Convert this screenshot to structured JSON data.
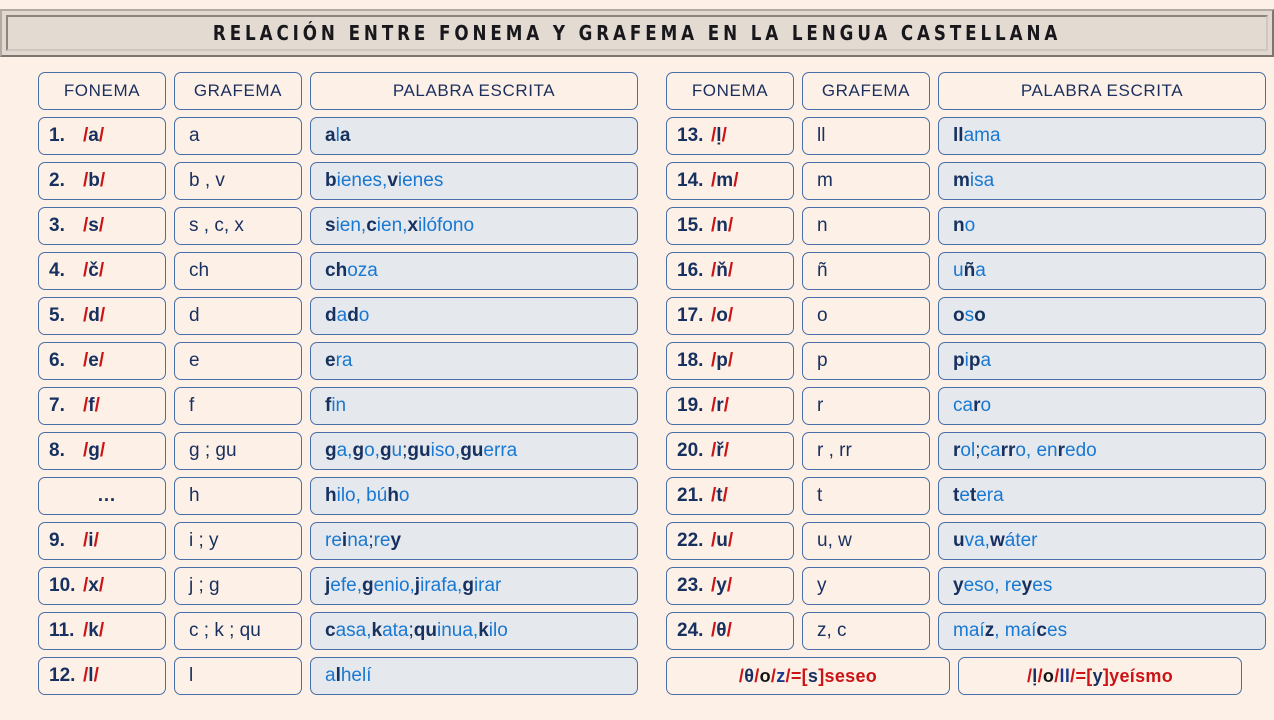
{
  "title": "RELACIÓN ENTRE FONEMA Y GRAFEMA EN LA LENGUA CASTELLANA",
  "columns": {
    "fonema": "FONEMA",
    "grafema": "GRAFEMA",
    "palabra": "PALABRA ESCRITA"
  },
  "left_rows": [
    {
      "num": "1.",
      "phoneme": "a",
      "grafema": "a",
      "palabra": "ala",
      "word_parts": [
        [
          "a",
          "g"
        ],
        [
          "l",
          "w"
        ],
        [
          "a",
          "g"
        ]
      ]
    },
    {
      "num": "2.",
      "phoneme": "b",
      "grafema": "b , v",
      "palabra": "bienes, vienes",
      "word_parts": [
        [
          "b",
          "g"
        ],
        [
          "ienes, ",
          "w"
        ],
        [
          "v",
          "g"
        ],
        [
          "ienes",
          "w"
        ]
      ]
    },
    {
      "num": "3.",
      "phoneme": "s",
      "grafema": "s , c, x",
      "palabra": "sien, cien, xilófono",
      "word_parts": [
        [
          "s",
          "g"
        ],
        [
          "ien, ",
          "w"
        ],
        [
          "c",
          "g"
        ],
        [
          "ien, ",
          "w"
        ],
        [
          "x",
          "g"
        ],
        [
          "ilófono",
          "w"
        ]
      ]
    },
    {
      "num": "4.",
      "phoneme": "č",
      "grafema": "ch",
      "palabra": "choza",
      "word_parts": [
        [
          "ch",
          "g"
        ],
        [
          "oza",
          "w"
        ]
      ]
    },
    {
      "num": "5.",
      "phoneme": "d",
      "grafema": "d",
      "palabra": "dado",
      "word_parts": [
        [
          "d",
          "g"
        ],
        [
          "a",
          "w"
        ],
        [
          "d",
          "g"
        ],
        [
          "o",
          "w"
        ]
      ]
    },
    {
      "num": "6.",
      "phoneme": "e",
      "grafema": "e",
      "palabra": "era",
      "word_parts": [
        [
          "e",
          "g"
        ],
        [
          "ra",
          "w"
        ]
      ]
    },
    {
      "num": "7.",
      "phoneme": "f",
      "grafema": "f",
      "palabra": "fin",
      "word_parts": [
        [
          "f",
          "g"
        ],
        [
          "in",
          "w"
        ]
      ]
    },
    {
      "num": "8.",
      "phoneme": "g",
      "grafema": "g ; gu",
      "palabra": "ga, go, gu ; guiso, guerra",
      "word_parts": [
        [
          "g",
          "g"
        ],
        [
          "a, ",
          "w"
        ],
        [
          "g",
          "g"
        ],
        [
          "o, ",
          "w"
        ],
        [
          "g",
          "g"
        ],
        [
          "u ",
          "w"
        ],
        [
          "; ",
          "sep"
        ],
        [
          "gu",
          "g"
        ],
        [
          "iso, ",
          "w"
        ],
        [
          "gu",
          "g"
        ],
        [
          "erra",
          "w"
        ]
      ]
    },
    {
      "num": "…",
      "phoneme": "",
      "grafema": "h",
      "palabra": "hilo, búho",
      "word_parts": [
        [
          "h",
          "g"
        ],
        [
          "ilo, bú",
          "w"
        ],
        [
          "h",
          "g"
        ],
        [
          "o",
          "w"
        ]
      ]
    },
    {
      "num": "9.",
      "phoneme": "i",
      "grafema": "i ; y",
      "palabra": "reina ; rey",
      "word_parts": [
        [
          "re",
          "w"
        ],
        [
          "i",
          "g"
        ],
        [
          "na ",
          "w"
        ],
        [
          "; ",
          "sep"
        ],
        [
          "re",
          "w"
        ],
        [
          "y",
          "g"
        ]
      ]
    },
    {
      "num": "10.",
      "phoneme": "x",
      "grafema": "j ; g",
      "palabra": "jefe, genio, jirafa, girar",
      "word_parts": [
        [
          "j",
          "g"
        ],
        [
          "efe, ",
          "w"
        ],
        [
          "g",
          "g"
        ],
        [
          "enio, ",
          "w"
        ],
        [
          "j",
          "g"
        ],
        [
          "irafa, ",
          "w"
        ],
        [
          "g",
          "g"
        ],
        [
          "irar",
          "w"
        ]
      ]
    },
    {
      "num": "11.",
      "phoneme": "k",
      "grafema": "c ; k ; qu",
      "palabra": "casa, kata ; quinua, kilo",
      "word_parts": [
        [
          "c",
          "g"
        ],
        [
          "asa, ",
          "w"
        ],
        [
          "k",
          "g"
        ],
        [
          "ata ",
          "w"
        ],
        [
          "; ",
          "sep"
        ],
        [
          "qu",
          "g"
        ],
        [
          "inua, ",
          "w"
        ],
        [
          "k",
          "g"
        ],
        [
          "ilo",
          "w"
        ]
      ]
    },
    {
      "num": "12.",
      "phoneme": "l",
      "grafema": "l",
      "palabra": "alhelí",
      "word_parts": [
        [
          "a",
          "w"
        ],
        [
          "l",
          "g"
        ],
        [
          "helí",
          "w"
        ]
      ]
    }
  ],
  "right_rows": [
    {
      "num": "13.",
      "phoneme": "ḷ",
      "grafema": "ll",
      "palabra": "llama",
      "word_parts": [
        [
          "ll",
          "g"
        ],
        [
          "ama",
          "w"
        ]
      ]
    },
    {
      "num": "14.",
      "phoneme": "m",
      "grafema": "m",
      "palabra": "misa",
      "word_parts": [
        [
          "m",
          "g"
        ],
        [
          "isa",
          "w"
        ]
      ]
    },
    {
      "num": "15.",
      "phoneme": "n",
      "grafema": "n",
      "palabra": "no",
      "word_parts": [
        [
          "n",
          "g"
        ],
        [
          "o",
          "w"
        ]
      ]
    },
    {
      "num": "16.",
      "phoneme": "ň",
      "grafema": "ñ",
      "palabra": "uña",
      "word_parts": [
        [
          "u",
          "w"
        ],
        [
          "ñ",
          "g"
        ],
        [
          "a",
          "w"
        ]
      ]
    },
    {
      "num": "17.",
      "phoneme": "o",
      "grafema": "o",
      "palabra": "oso",
      "word_parts": [
        [
          "o",
          "g"
        ],
        [
          "s",
          "w"
        ],
        [
          "o",
          "g"
        ]
      ]
    },
    {
      "num": "18.",
      "phoneme": "p",
      "grafema": "p",
      "palabra": "pipa",
      "word_parts": [
        [
          "p",
          "g"
        ],
        [
          "i",
          "w"
        ],
        [
          "p",
          "g"
        ],
        [
          "a",
          "w"
        ]
      ]
    },
    {
      "num": "19.",
      "phoneme": "r",
      "grafema": "r",
      "palabra": "caro",
      "word_parts": [
        [
          "ca",
          "w"
        ],
        [
          "r",
          "g"
        ],
        [
          "o",
          "w"
        ]
      ]
    },
    {
      "num": "20.",
      "phoneme": "ř",
      "grafema": "r , rr",
      "palabra": "rol ; carro, enredo",
      "word_parts": [
        [
          "r",
          "g"
        ],
        [
          "ol ",
          "w"
        ],
        [
          "; ",
          "sep"
        ],
        [
          "ca",
          "w"
        ],
        [
          "rr",
          "g"
        ],
        [
          "o, en",
          "w"
        ],
        [
          "r",
          "g"
        ],
        [
          "edo",
          "w"
        ]
      ]
    },
    {
      "num": "21.",
      "phoneme": "t",
      "grafema": "t",
      "palabra": "tetera",
      "word_parts": [
        [
          "t",
          "g"
        ],
        [
          "e",
          "w"
        ],
        [
          "t",
          "g"
        ],
        [
          "era",
          "w"
        ]
      ]
    },
    {
      "num": "22.",
      "phoneme": "u",
      "grafema": "u, w",
      "palabra": "uva, wáter",
      "word_parts": [
        [
          "u",
          "g"
        ],
        [
          "va, ",
          "w"
        ],
        [
          "w",
          "g"
        ],
        [
          "áter",
          "w"
        ]
      ]
    },
    {
      "num": "23.",
      "phoneme": "y",
      "grafema": "y",
      "palabra": "yeso, reyes",
      "word_parts": [
        [
          "y",
          "g"
        ],
        [
          "eso, re",
          "w"
        ],
        [
          "y",
          "g"
        ],
        [
          "es",
          "w"
        ]
      ]
    },
    {
      "num": "24.",
      "phoneme": "θ",
      "grafema": "z, c",
      "palabra": "maíz, maíces",
      "word_parts": [
        [
          "ma",
          "w"
        ],
        [
          "í",
          "w"
        ],
        [
          "z",
          "g"
        ],
        [
          ", ma",
          "w"
        ],
        [
          "í",
          "w"
        ],
        [
          "c",
          "g"
        ],
        [
          "es",
          "w"
        ]
      ]
    }
  ],
  "notes": {
    "seseo": {
      "text": "/ θ / o / z / = [ s ] seseo",
      "parts": [
        [
          "/ ",
          "nred"
        ],
        [
          "θ",
          "nnavy"
        ],
        [
          " / ",
          "nred"
        ],
        [
          "o",
          "nblack"
        ],
        [
          " / ",
          "nred"
        ],
        [
          "z",
          "nblue"
        ],
        [
          " / ",
          "nred"
        ],
        [
          "= ",
          "nred"
        ],
        [
          "[ ",
          "nred"
        ],
        [
          "s",
          "nnavy"
        ],
        [
          " ] ",
          "nred"
        ],
        [
          "seseo",
          "nred"
        ]
      ]
    },
    "yeismo": {
      "text": "/ ḷ / o / ll / = [ y ] yeísmo",
      "parts": [
        [
          "/ ",
          "nred"
        ],
        [
          "ḷ",
          "nnavy"
        ],
        [
          " / ",
          "nred"
        ],
        [
          "o",
          "nblack"
        ],
        [
          " / ",
          "nred"
        ],
        [
          "ll",
          "nblue"
        ],
        [
          " / ",
          "nred"
        ],
        [
          "= ",
          "nred"
        ],
        [
          "[ ",
          "nred"
        ],
        [
          "y",
          "nnavy"
        ],
        [
          " ] ",
          "nred"
        ],
        [
          "yeísmo",
          "nred"
        ]
      ]
    }
  },
  "colors": {
    "page_background": "#fdf0e6",
    "title_background": "#e3dad2",
    "cell_border": "#4a6ea8",
    "word_cell_background": "#e5e8ec",
    "navy": "#16305f",
    "blue": "#1878d2",
    "red": "#cc1417"
  }
}
